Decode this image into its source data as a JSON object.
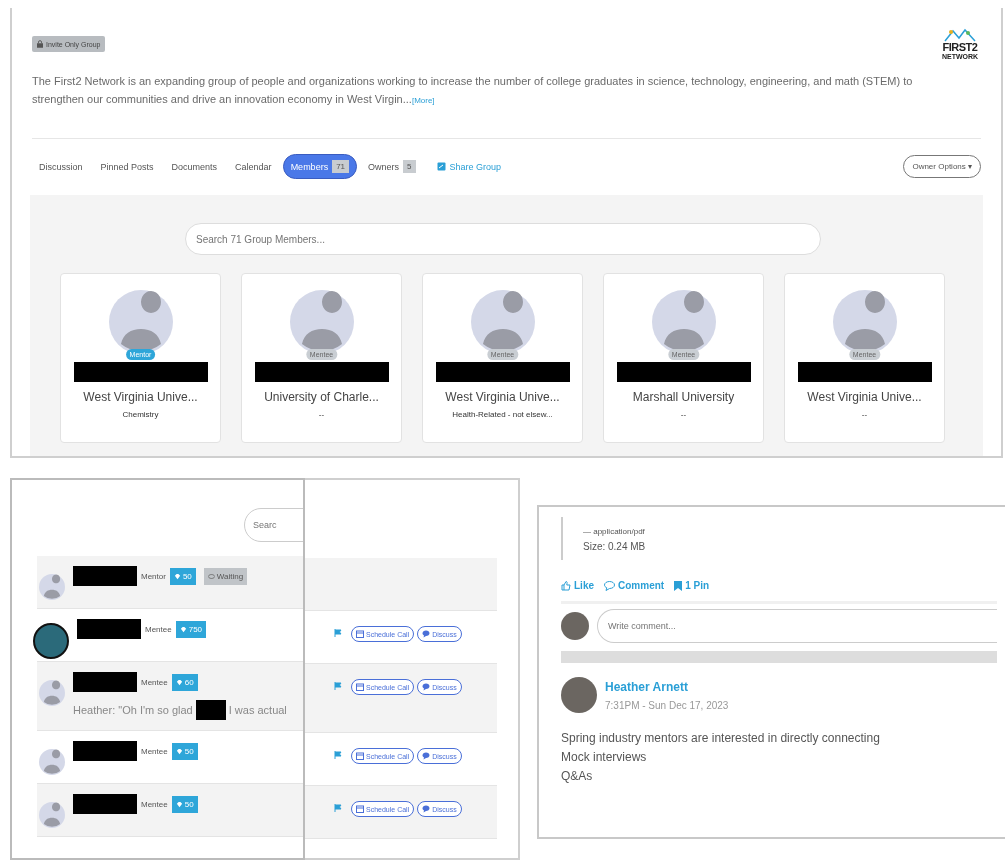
{
  "group": {
    "privacy_badge": "Invite Only Group",
    "description": "The First2 Network is an expanding group of people and organizations working to increase the number of college graduates in science, technology, engineering, and math (STEM) to strengthen our communities and drive an innovation economy in West Virgin...",
    "more_link": "[More]",
    "logo": {
      "line_1": "FIRST2",
      "line_2": "NETWORK"
    }
  },
  "tabs": [
    {
      "label": "Discussion",
      "selected": false
    },
    {
      "label": "Pinned Posts",
      "selected": false
    },
    {
      "label": "Documents",
      "selected": false
    },
    {
      "label": "Calendar",
      "selected": false
    },
    {
      "label": "Members",
      "count": "71",
      "selected": true
    },
    {
      "label": "Owners",
      "count": "5",
      "selected": false
    }
  ],
  "share_link": "Share Group",
  "owner_options": "Owner Options ▾",
  "member_search": {
    "placeholder": "Search 71 Group Members..."
  },
  "members": [
    {
      "role": "Mentor",
      "kind": "mentor",
      "school": "West Virginia Unive...",
      "field": "Chemistry"
    },
    {
      "role": "Mentee",
      "kind": "mentee",
      "school": "University of Charle...",
      "field": "--"
    },
    {
      "role": "Mentee",
      "kind": "mentee",
      "school": "West Virginia Unive...",
      "field": "Health-Related - not elsew..."
    },
    {
      "role": "Mentee",
      "kind": "mentee",
      "school": "Marshall University",
      "field": "--"
    },
    {
      "role": "Mentee",
      "kind": "mentee",
      "school": "West Virginia Unive...",
      "field": "--"
    }
  ],
  "chat": {
    "search": {
      "placeholder": "Searc"
    },
    "conversations": [
      {
        "kind": "silhouette",
        "role": "Mentor",
        "points": "50",
        "status": "Waiting"
      },
      {
        "kind": "filled",
        "role": "Mentee",
        "points": "750",
        "schedule_label": "Schedule Call",
        "discuss_label": "Discuss"
      },
      {
        "kind": "silhouette",
        "role": "Mentee",
        "points": "60",
        "message_before": "Heather: \"Oh I'm so glad",
        "message_after": "I was actual",
        "schedule_label": "Schedule Call",
        "discuss_label": "Discuss"
      },
      {
        "kind": "silhouette",
        "role": "Mentee",
        "points": "50",
        "schedule_label": "Schedule Call",
        "discuss_label": "Discuss"
      },
      {
        "kind": "silhouette",
        "role": "Mentee",
        "points": "50",
        "schedule_label": "Schedule Call",
        "discuss_label": "Discuss"
      }
    ]
  },
  "post": {
    "attachment_type": "— application/pdf",
    "attachment_size": "Size: 0.24 MB",
    "like": "Like",
    "comment": "Comment",
    "pins": "1 Pin",
    "comment_field": {
      "placeholder": "Write comment..."
    },
    "author": "Heather Arnett",
    "time": "7:31PM - Sun Dec 17, 2023",
    "lines": [
      "Spring industry mentors are interested in directly connecting",
      "Mock interviews",
      "Q&As"
    ]
  }
}
